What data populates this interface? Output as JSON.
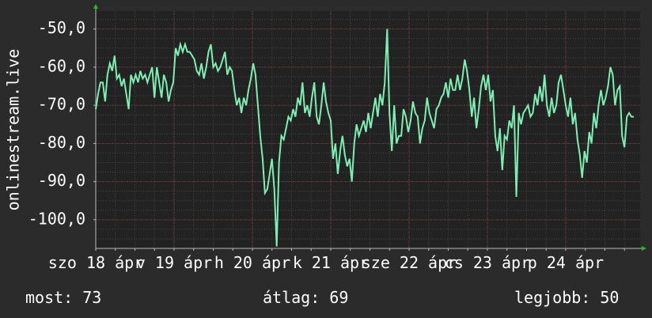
{
  "chart_data": {
    "type": "line",
    "ylabel": "onlinestream.live",
    "ylim": [
      -107.5,
      -45.3
    ],
    "y_ticks": [
      {
        "value": -50,
        "label": "-50,0"
      },
      {
        "value": -60,
        "label": "-60,0"
      },
      {
        "value": -70,
        "label": "-70,0"
      },
      {
        "value": -80,
        "label": "-80,0"
      },
      {
        "value": -90,
        "label": "-90,0"
      },
      {
        "value": -100,
        "label": "-100,0"
      }
    ],
    "x_ticks": [
      {
        "label": "szo 18 ápr",
        "t": 0
      },
      {
        "label": "v 19 ápr",
        "t": 1
      },
      {
        "label": "h 20 ápr",
        "t": 2
      },
      {
        "label": "k 21 ápr",
        "t": 3
      },
      {
        "label": "sze 22 ápr",
        "t": 4
      },
      {
        "label": "cs 23 ápr",
        "t": 5
      },
      {
        "label": "p 24 ápr",
        "t": 6
      }
    ],
    "x_range": [
      0,
      6.95
    ],
    "grid": true,
    "series": [
      {
        "color": "#7cf0b4",
        "points": [
          [
            0.0,
            -71
          ],
          [
            0.03,
            -67
          ],
          [
            0.06,
            -64
          ],
          [
            0.09,
            -64
          ],
          [
            0.12,
            -69
          ],
          [
            0.15,
            -62
          ],
          [
            0.18,
            -59
          ],
          [
            0.21,
            -61
          ],
          [
            0.24,
            -57
          ],
          [
            0.27,
            -63
          ],
          [
            0.3,
            -62
          ],
          [
            0.33,
            -65
          ],
          [
            0.36,
            -63
          ],
          [
            0.39,
            -67
          ],
          [
            0.42,
            -71
          ],
          [
            0.45,
            -62
          ],
          [
            0.48,
            -64
          ],
          [
            0.51,
            -62
          ],
          [
            0.54,
            -64
          ],
          [
            0.57,
            -61
          ],
          [
            0.6,
            -63
          ],
          [
            0.63,
            -62
          ],
          [
            0.66,
            -64
          ],
          [
            0.69,
            -62
          ],
          [
            0.72,
            -60
          ],
          [
            0.75,
            -68
          ],
          [
            0.78,
            -60
          ],
          [
            0.81,
            -64
          ],
          [
            0.84,
            -68
          ],
          [
            0.87,
            -62
          ],
          [
            0.9,
            -64
          ],
          [
            0.93,
            -69
          ],
          [
            0.96,
            -66
          ],
          [
            0.99,
            -64
          ],
          [
            1.02,
            -55
          ],
          [
            1.05,
            -57
          ],
          [
            1.08,
            -54
          ],
          [
            1.11,
            -56
          ],
          [
            1.14,
            -54
          ],
          [
            1.17,
            -56
          ],
          [
            1.2,
            -56
          ],
          [
            1.23,
            -57
          ],
          [
            1.26,
            -58
          ],
          [
            1.29,
            -61
          ],
          [
            1.32,
            -62
          ],
          [
            1.35,
            -59
          ],
          [
            1.38,
            -63
          ],
          [
            1.41,
            -60
          ],
          [
            1.44,
            -56
          ],
          [
            1.47,
            -54
          ],
          [
            1.5,
            -60
          ],
          [
            1.53,
            -59
          ],
          [
            1.56,
            -61
          ],
          [
            1.59,
            -60
          ],
          [
            1.62,
            -58
          ],
          [
            1.65,
            -56
          ],
          [
            1.68,
            -62
          ],
          [
            1.71,
            -60
          ],
          [
            1.74,
            -61
          ],
          [
            1.77,
            -66
          ],
          [
            1.8,
            -70
          ],
          [
            1.83,
            -68
          ],
          [
            1.86,
            -72
          ],
          [
            1.89,
            -68
          ],
          [
            1.92,
            -70
          ],
          [
            1.95,
            -66
          ],
          [
            1.98,
            -63
          ],
          [
            2.01,
            -59
          ],
          [
            2.04,
            -62
          ],
          [
            2.07,
            -70
          ],
          [
            2.1,
            -78
          ],
          [
            2.13,
            -84
          ],
          [
            2.16,
            -93
          ],
          [
            2.19,
            -92
          ],
          [
            2.22,
            -88
          ],
          [
            2.25,
            -84
          ],
          [
            2.28,
            -92
          ],
          [
            2.31,
            -107
          ],
          [
            2.34,
            -85
          ],
          [
            2.37,
            -78
          ],
          [
            2.4,
            -79
          ],
          [
            2.43,
            -76
          ],
          [
            2.46,
            -73
          ],
          [
            2.49,
            -74
          ],
          [
            2.52,
            -71
          ],
          [
            2.55,
            -73
          ],
          [
            2.58,
            -68
          ],
          [
            2.61,
            -70
          ],
          [
            2.64,
            -64
          ],
          [
            2.67,
            -72
          ],
          [
            2.7,
            -70
          ],
          [
            2.73,
            -73
          ],
          [
            2.76,
            -68
          ],
          [
            2.79,
            -64
          ],
          [
            2.82,
            -73
          ],
          [
            2.85,
            -75
          ],
          [
            2.88,
            -70
          ],
          [
            2.91,
            -64
          ],
          [
            2.94,
            -69
          ],
          [
            2.97,
            -72
          ],
          [
            3.0,
            -74
          ],
          [
            3.03,
            -84
          ],
          [
            3.06,
            -80
          ],
          [
            3.09,
            -88
          ],
          [
            3.12,
            -82
          ],
          [
            3.15,
            -78
          ],
          [
            3.18,
            -83
          ],
          [
            3.21,
            -86
          ],
          [
            3.24,
            -84
          ],
          [
            3.27,
            -90
          ],
          [
            3.3,
            -80
          ],
          [
            3.33,
            -75
          ],
          [
            3.36,
            -78
          ],
          [
            3.39,
            -76
          ],
          [
            3.42,
            -74
          ],
          [
            3.45,
            -77
          ],
          [
            3.48,
            -72
          ],
          [
            3.51,
            -76
          ],
          [
            3.54,
            -72
          ],
          [
            3.57,
            -68
          ],
          [
            3.6,
            -73
          ],
          [
            3.63,
            -67
          ],
          [
            3.66,
            -70
          ],
          [
            3.69,
            -64
          ],
          [
            3.72,
            -50
          ],
          [
            3.75,
            -72
          ],
          [
            3.78,
            -82
          ],
          [
            3.81,
            -70
          ],
          [
            3.84,
            -80
          ],
          [
            3.87,
            -78
          ],
          [
            3.9,
            -78
          ],
          [
            3.93,
            -71
          ],
          [
            3.96,
            -73
          ],
          [
            3.99,
            -77
          ],
          [
            4.02,
            -74
          ],
          [
            4.05,
            -69
          ],
          [
            4.08,
            -72
          ],
          [
            4.11,
            -73
          ],
          [
            4.14,
            -80
          ],
          [
            4.17,
            -76
          ],
          [
            4.2,
            -74
          ],
          [
            4.23,
            -68
          ],
          [
            4.26,
            -72
          ],
          [
            4.29,
            -74
          ],
          [
            4.32,
            -76
          ],
          [
            4.35,
            -71
          ],
          [
            4.38,
            -70
          ],
          [
            4.41,
            -68
          ],
          [
            4.44,
            -67
          ],
          [
            4.47,
            -64
          ],
          [
            4.5,
            -68
          ],
          [
            4.53,
            -63
          ],
          [
            4.56,
            -66
          ],
          [
            4.59,
            -66
          ],
          [
            4.62,
            -62
          ],
          [
            4.65,
            -66
          ],
          [
            4.68,
            -63
          ],
          [
            4.71,
            -58
          ],
          [
            4.74,
            -61
          ],
          [
            4.77,
            -66
          ],
          [
            4.8,
            -73
          ],
          [
            4.83,
            -68
          ],
          [
            4.86,
            -76
          ],
          [
            4.89,
            -71
          ],
          [
            4.92,
            -65
          ],
          [
            4.95,
            -62
          ],
          [
            4.98,
            -66
          ],
          [
            5.01,
            -62
          ],
          [
            5.04,
            -69
          ],
          [
            5.07,
            -66
          ],
          [
            5.1,
            -78
          ],
          [
            5.13,
            -82
          ],
          [
            5.16,
            -76
          ],
          [
            5.19,
            -87
          ],
          [
            5.22,
            -78
          ],
          [
            5.25,
            -79
          ],
          [
            5.28,
            -74
          ],
          [
            5.31,
            -76
          ],
          [
            5.34,
            -70
          ],
          [
            5.37,
            -94
          ],
          [
            5.4,
            -72
          ],
          [
            5.43,
            -75
          ],
          [
            5.46,
            -72
          ],
          [
            5.49,
            -71
          ],
          [
            5.52,
            -70
          ],
          [
            5.55,
            -73
          ],
          [
            5.58,
            -72
          ],
          [
            5.61,
            -67
          ],
          [
            5.64,
            -70
          ],
          [
            5.67,
            -65
          ],
          [
            5.7,
            -69
          ],
          [
            5.73,
            -62
          ],
          [
            5.76,
            -70
          ],
          [
            5.79,
            -73
          ],
          [
            5.82,
            -68
          ],
          [
            5.85,
            -72
          ],
          [
            5.88,
            -70
          ],
          [
            5.91,
            -64
          ],
          [
            5.94,
            -62
          ],
          [
            5.97,
            -66
          ],
          [
            6.0,
            -70
          ],
          [
            6.03,
            -73
          ],
          [
            6.06,
            -68
          ],
          [
            6.09,
            -75
          ],
          [
            6.12,
            -72
          ],
          [
            6.15,
            -79
          ],
          [
            6.18,
            -83
          ],
          [
            6.21,
            -89
          ],
          [
            6.24,
            -82
          ],
          [
            6.27,
            -85
          ],
          [
            6.3,
            -77
          ],
          [
            6.33,
            -80
          ],
          [
            6.36,
            -72
          ],
          [
            6.39,
            -76
          ],
          [
            6.42,
            -70
          ],
          [
            6.45,
            -66
          ],
          [
            6.48,
            -70
          ],
          [
            6.51,
            -68
          ],
          [
            6.54,
            -65
          ],
          [
            6.57,
            -60
          ],
          [
            6.6,
            -62
          ],
          [
            6.63,
            -70
          ],
          [
            6.66,
            -66
          ],
          [
            6.69,
            -65
          ],
          [
            6.72,
            -78
          ],
          [
            6.75,
            -81
          ],
          [
            6.78,
            -73
          ],
          [
            6.81,
            -72
          ],
          [
            6.84,
            -73
          ],
          [
            6.87,
            -73
          ]
        ]
      }
    ]
  },
  "stats": {
    "now": "most: 73",
    "average": "átlag: 69",
    "best": "legjobb: 50"
  }
}
